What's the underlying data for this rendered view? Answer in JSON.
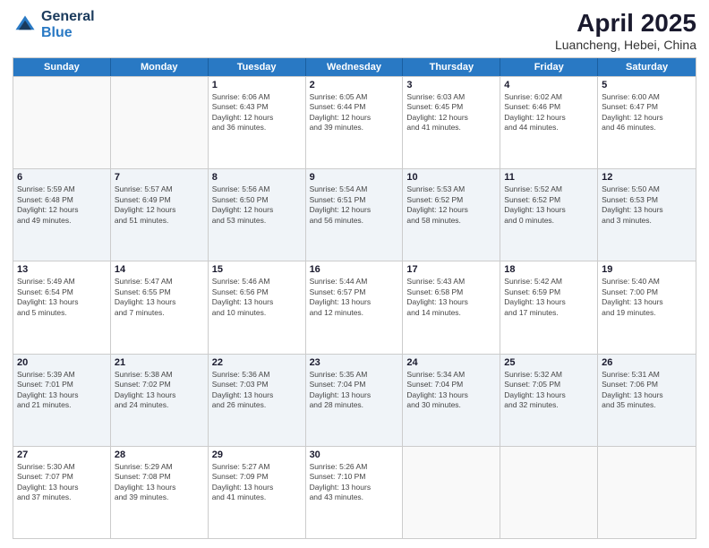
{
  "logo": {
    "general": "General",
    "blue": "Blue"
  },
  "title": {
    "month": "April 2025",
    "location": "Luancheng, Hebei, China"
  },
  "header_days": [
    "Sunday",
    "Monday",
    "Tuesday",
    "Wednesday",
    "Thursday",
    "Friday",
    "Saturday"
  ],
  "weeks": [
    [
      {
        "day": "",
        "info": ""
      },
      {
        "day": "",
        "info": ""
      },
      {
        "day": "1",
        "info": "Sunrise: 6:06 AM\nSunset: 6:43 PM\nDaylight: 12 hours\nand 36 minutes."
      },
      {
        "day": "2",
        "info": "Sunrise: 6:05 AM\nSunset: 6:44 PM\nDaylight: 12 hours\nand 39 minutes."
      },
      {
        "day": "3",
        "info": "Sunrise: 6:03 AM\nSunset: 6:45 PM\nDaylight: 12 hours\nand 41 minutes."
      },
      {
        "day": "4",
        "info": "Sunrise: 6:02 AM\nSunset: 6:46 PM\nDaylight: 12 hours\nand 44 minutes."
      },
      {
        "day": "5",
        "info": "Sunrise: 6:00 AM\nSunset: 6:47 PM\nDaylight: 12 hours\nand 46 minutes."
      }
    ],
    [
      {
        "day": "6",
        "info": "Sunrise: 5:59 AM\nSunset: 6:48 PM\nDaylight: 12 hours\nand 49 minutes."
      },
      {
        "day": "7",
        "info": "Sunrise: 5:57 AM\nSunset: 6:49 PM\nDaylight: 12 hours\nand 51 minutes."
      },
      {
        "day": "8",
        "info": "Sunrise: 5:56 AM\nSunset: 6:50 PM\nDaylight: 12 hours\nand 53 minutes."
      },
      {
        "day": "9",
        "info": "Sunrise: 5:54 AM\nSunset: 6:51 PM\nDaylight: 12 hours\nand 56 minutes."
      },
      {
        "day": "10",
        "info": "Sunrise: 5:53 AM\nSunset: 6:52 PM\nDaylight: 12 hours\nand 58 minutes."
      },
      {
        "day": "11",
        "info": "Sunrise: 5:52 AM\nSunset: 6:52 PM\nDaylight: 13 hours\nand 0 minutes."
      },
      {
        "day": "12",
        "info": "Sunrise: 5:50 AM\nSunset: 6:53 PM\nDaylight: 13 hours\nand 3 minutes."
      }
    ],
    [
      {
        "day": "13",
        "info": "Sunrise: 5:49 AM\nSunset: 6:54 PM\nDaylight: 13 hours\nand 5 minutes."
      },
      {
        "day": "14",
        "info": "Sunrise: 5:47 AM\nSunset: 6:55 PM\nDaylight: 13 hours\nand 7 minutes."
      },
      {
        "day": "15",
        "info": "Sunrise: 5:46 AM\nSunset: 6:56 PM\nDaylight: 13 hours\nand 10 minutes."
      },
      {
        "day": "16",
        "info": "Sunrise: 5:44 AM\nSunset: 6:57 PM\nDaylight: 13 hours\nand 12 minutes."
      },
      {
        "day": "17",
        "info": "Sunrise: 5:43 AM\nSunset: 6:58 PM\nDaylight: 13 hours\nand 14 minutes."
      },
      {
        "day": "18",
        "info": "Sunrise: 5:42 AM\nSunset: 6:59 PM\nDaylight: 13 hours\nand 17 minutes."
      },
      {
        "day": "19",
        "info": "Sunrise: 5:40 AM\nSunset: 7:00 PM\nDaylight: 13 hours\nand 19 minutes."
      }
    ],
    [
      {
        "day": "20",
        "info": "Sunrise: 5:39 AM\nSunset: 7:01 PM\nDaylight: 13 hours\nand 21 minutes."
      },
      {
        "day": "21",
        "info": "Sunrise: 5:38 AM\nSunset: 7:02 PM\nDaylight: 13 hours\nand 24 minutes."
      },
      {
        "day": "22",
        "info": "Sunrise: 5:36 AM\nSunset: 7:03 PM\nDaylight: 13 hours\nand 26 minutes."
      },
      {
        "day": "23",
        "info": "Sunrise: 5:35 AM\nSunset: 7:04 PM\nDaylight: 13 hours\nand 28 minutes."
      },
      {
        "day": "24",
        "info": "Sunrise: 5:34 AM\nSunset: 7:04 PM\nDaylight: 13 hours\nand 30 minutes."
      },
      {
        "day": "25",
        "info": "Sunrise: 5:32 AM\nSunset: 7:05 PM\nDaylight: 13 hours\nand 32 minutes."
      },
      {
        "day": "26",
        "info": "Sunrise: 5:31 AM\nSunset: 7:06 PM\nDaylight: 13 hours\nand 35 minutes."
      }
    ],
    [
      {
        "day": "27",
        "info": "Sunrise: 5:30 AM\nSunset: 7:07 PM\nDaylight: 13 hours\nand 37 minutes."
      },
      {
        "day": "28",
        "info": "Sunrise: 5:29 AM\nSunset: 7:08 PM\nDaylight: 13 hours\nand 39 minutes."
      },
      {
        "day": "29",
        "info": "Sunrise: 5:27 AM\nSunset: 7:09 PM\nDaylight: 13 hours\nand 41 minutes."
      },
      {
        "day": "30",
        "info": "Sunrise: 5:26 AM\nSunset: 7:10 PM\nDaylight: 13 hours\nand 43 minutes."
      },
      {
        "day": "",
        "info": ""
      },
      {
        "day": "",
        "info": ""
      },
      {
        "day": "",
        "info": ""
      }
    ]
  ]
}
